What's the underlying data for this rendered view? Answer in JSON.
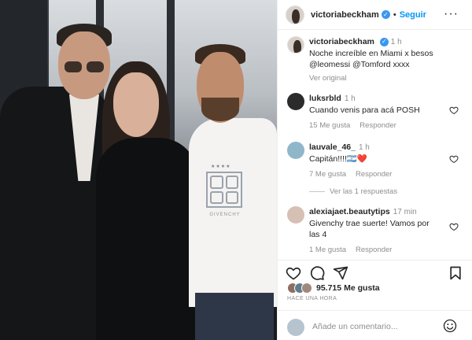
{
  "post": {
    "username": "victoriabeckham",
    "follow_label": "Seguir",
    "dot": "•",
    "more_label": "•••"
  },
  "caption": {
    "username": "victoriabeckham",
    "time": "1 h",
    "text": "Noche increíble en Miami x besos @leomessi @Tomford xxxx",
    "translate_label": "Ver original"
  },
  "comments": [
    {
      "username": "luksrbld",
      "time": "1 h",
      "text": "Cuando venis para acá POSH",
      "likes": "15 Me gusta",
      "reply": "Responder",
      "avatar_color": "#2b2b2b"
    },
    {
      "username": "lauvale_46_",
      "time": "1 h",
      "text": "Capitán!!!!🇦🇷❤️",
      "likes": "7 Me gusta",
      "reply": "Responder",
      "avatar_color": "#8fb7c9"
    },
    {
      "username": "alexiajaet.beautytips",
      "time": "17 min",
      "text": "Givenchy trae suerte! Vamos por las 4",
      "likes": "1 Me gusta",
      "reply": "Responder",
      "avatar_color": "#d6c0b4"
    }
  ],
  "view_replies": "Ver las 1 respuestas",
  "likes": {
    "count": "95.715",
    "word": "Me gusta"
  },
  "posted_ago": "HACE UNA HORA",
  "comment_input": {
    "placeholder": "Añade un comentario..."
  },
  "photo": {
    "shirt_brand": "GIVENCHY",
    "shirt_stars": "★★★★"
  },
  "colors": {
    "link_blue": "#0095f6",
    "verified_blue": "#3897f0",
    "muted": "#8e8e8e",
    "heart_red": "#ed4956"
  }
}
